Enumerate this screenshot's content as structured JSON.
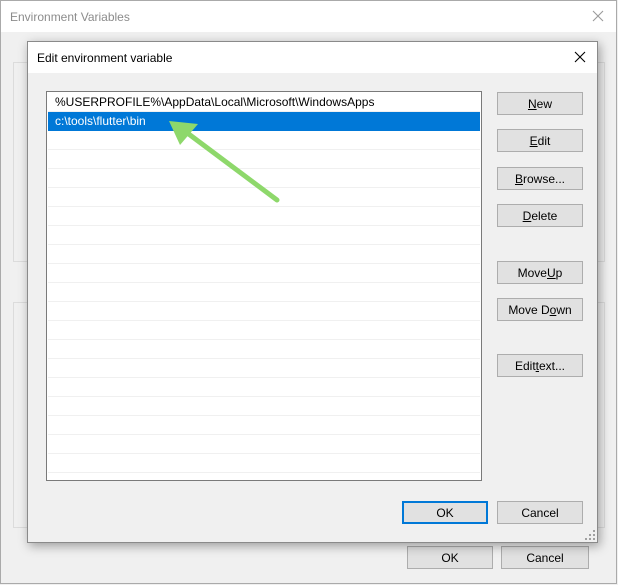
{
  "parent_window": {
    "title": "Environment Variables",
    "ok_label": "OK",
    "cancel_label": "Cancel"
  },
  "dialog": {
    "title": "Edit environment variable",
    "paths": [
      "%USERPROFILE%\\AppData\\Local\\Microsoft\\WindowsApps",
      "c:\\tools\\flutter\\bin"
    ],
    "selected_index": 1,
    "buttons": {
      "new": {
        "pre": "",
        "key": "N",
        "post": "ew"
      },
      "edit": {
        "pre": "",
        "key": "E",
        "post": "dit"
      },
      "browse": {
        "pre": "",
        "key": "B",
        "post": "rowse..."
      },
      "delete": {
        "pre": "",
        "key": "D",
        "post": "elete"
      },
      "move_up": {
        "pre": "Move ",
        "key": "U",
        "post": "p"
      },
      "move_down": {
        "pre": "Move D",
        "key": "o",
        "post": "wn"
      },
      "edit_text": {
        "pre": "Edit ",
        "key": "t",
        "post": "ext..."
      }
    },
    "ok_label": "OK",
    "cancel_label": "Cancel"
  },
  "annotation": {
    "color": "#8ed86b"
  }
}
